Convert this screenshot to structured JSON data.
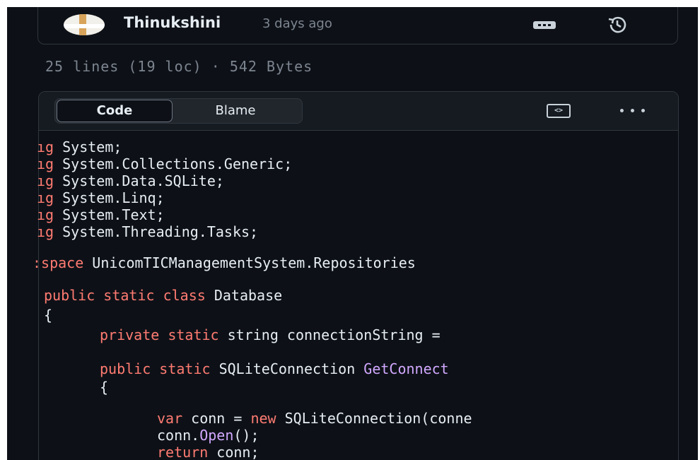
{
  "commit": {
    "author": "Thinukshini",
    "time_ago": "3 days ago",
    "history_icon": "history-icon"
  },
  "file": {
    "info": "25 lines (19 loc) · 542 Bytes"
  },
  "toolbar": {
    "code_tab": "Code",
    "blame_tab": "Blame",
    "raw_icon": "code-square-icon",
    "raw_glyph": "<>",
    "more_icon": "kebab-horizontal-icon"
  },
  "code": {
    "lines": [
      {
        "prefix": "ıg",
        "text": " System;"
      },
      {
        "prefix": "ıg",
        "text": " System.Collections.Generic;"
      },
      {
        "prefix": "ıg",
        "text": " System.Data.SQLite;"
      },
      {
        "prefix": "ıg",
        "text": " System.Linq;"
      },
      {
        "prefix": "ıg",
        "text": " System.Text;"
      },
      {
        "prefix": "ıg",
        "text": " System.Threading.Tasks;"
      },
      {
        "prefix": ":space",
        "text": " UnicomTICManagementSystem.Repositories"
      },
      {
        "kw": "public static class",
        "text": " Database"
      },
      {
        "text": "{"
      },
      {
        "kw": "private static",
        "text": " string connectionString ="
      },
      {
        "kw": "public static",
        "text": " SQLiteConnection ",
        "fn": "GetConnect"
      },
      {
        "text": "{"
      },
      {
        "kw": "var",
        "text": " conn = ",
        "kw2": "new",
        "text2": " SQLiteConnection(conne"
      },
      {
        "text": "conn.",
        "fn": "Open",
        "text2": "();"
      },
      {
        "kw": "return",
        "text": " conn;"
      }
    ]
  },
  "colors": {
    "background": "#0d1117",
    "keyword": "#ff7b72",
    "function": "#d2a8ff",
    "muted": "#7d8590"
  }
}
